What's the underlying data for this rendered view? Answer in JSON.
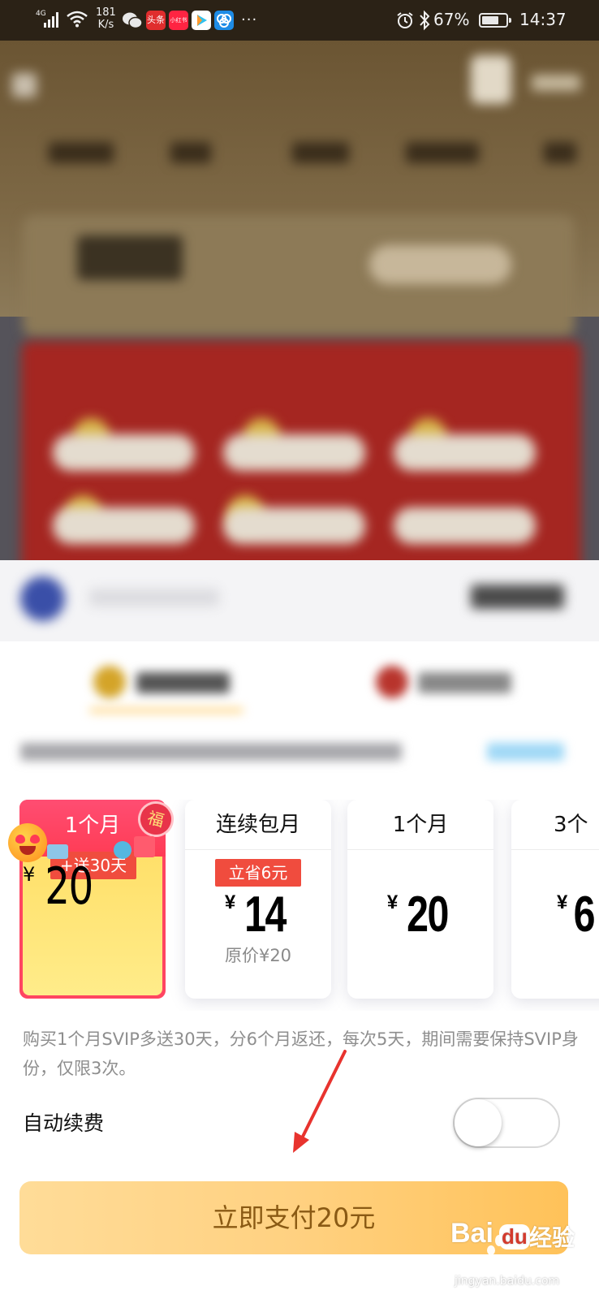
{
  "status_bar": {
    "network": "4G",
    "speed_value": "181",
    "speed_unit": "K/s",
    "app_icon_1": "头条",
    "app_icon_2": "小红书",
    "more": "···",
    "battery": "67%",
    "time": "14:37"
  },
  "plans": [
    {
      "title": "1个月",
      "tag": "+送30天",
      "currency": "¥",
      "price": "20",
      "selected": true
    },
    {
      "title": "连续包月",
      "tag": "立省6元",
      "currency": "¥",
      "price": "14",
      "original": "原价¥20",
      "selected": false
    },
    {
      "title": "1个月",
      "currency": "¥",
      "price": "20",
      "selected": false
    },
    {
      "title": "3个",
      "currency": "¥",
      "price": "6",
      "selected": false
    }
  ],
  "badge": "福",
  "description": "购买1个月SVIP多送30天，分6个月返还，每次5天，期间需要保持SVIP身份，仅限3次。",
  "auto_renew": {
    "label": "自动续费",
    "enabled": false
  },
  "pay_button": "立即支付20元",
  "watermark": {
    "brand_a": "Bai",
    "brand_b": "du",
    "brand_c": "经验",
    "url": "jingyan.baidu.com"
  },
  "colors": {
    "selected_card": "#ff4561",
    "tag_red": "#f04c3e",
    "pay_gradient_start": "#ffdc98",
    "pay_gradient_end": "#ffc259",
    "pay_text": "#8a5a14"
  }
}
